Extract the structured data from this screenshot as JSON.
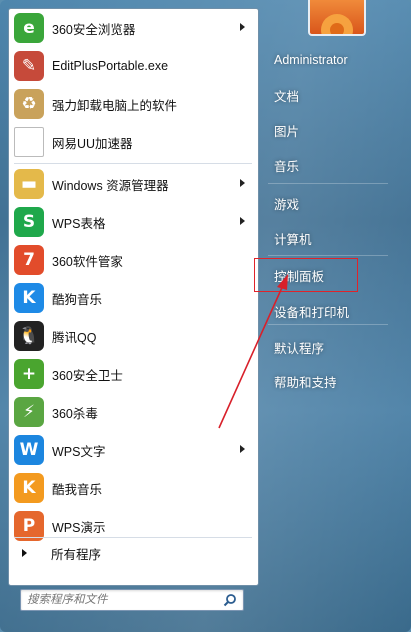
{
  "left_items": [
    {
      "label": "360安全浏览器",
      "icon": "360-browser-icon",
      "color": "#3aa63a",
      "glyph": "e",
      "submenu": true
    },
    {
      "label": "EditPlusPortable.exe",
      "icon": "editplus-icon",
      "color": "#c64a3a",
      "glyph": "✎",
      "submenu": false
    },
    {
      "label": "强力卸载电脑上的软件",
      "icon": "uninstall-box-icon",
      "color": "#c9a25b",
      "glyph": "♻",
      "submenu": false
    },
    {
      "label": "网易UU加速器",
      "icon": "document-icon",
      "color": "#ffffff",
      "glyph": "",
      "submenu": false
    },
    {
      "label": "Windows 资源管理器",
      "icon": "folder-icon",
      "color": "#e4b94a",
      "glyph": "▬",
      "submenu": true
    },
    {
      "label": "WPS表格",
      "icon": "wps-sheet-icon",
      "color": "#1fa84b",
      "glyph": "S",
      "submenu": true
    },
    {
      "label": "360软件管家",
      "icon": "software-manager-icon",
      "color": "#e24c2b",
      "glyph": "7",
      "submenu": false
    },
    {
      "label": "酷狗音乐",
      "icon": "kugou-icon",
      "color": "#1e8ae6",
      "glyph": "K",
      "submenu": false
    },
    {
      "label": "腾讯QQ",
      "icon": "qq-penguin-icon",
      "color": "#222222",
      "glyph": "🐧",
      "submenu": false
    },
    {
      "label": "360安全卫士",
      "icon": "360-guard-icon",
      "color": "#4aa52f",
      "glyph": "+",
      "submenu": false
    },
    {
      "label": "360杀毒",
      "icon": "360-antivirus-icon",
      "color": "#5aa642",
      "glyph": "⚡",
      "submenu": false
    },
    {
      "label": "WPS文字",
      "icon": "wps-writer-icon",
      "color": "#1c86df",
      "glyph": "W",
      "submenu": true
    },
    {
      "label": "酷我音乐",
      "icon": "kuwo-music-icon",
      "color": "#f39a1f",
      "glyph": "K",
      "submenu": false
    },
    {
      "label": "WPS演示",
      "icon": "wps-presentation-icon",
      "color": "#e5672d",
      "glyph": "P",
      "submenu": false
    }
  ],
  "all_programs": "所有程序",
  "search_placeholder": "搜索程序和文件",
  "right_items": [
    {
      "label": "Administrator",
      "name": "user-administrator"
    },
    {
      "label": "文档",
      "name": "documents"
    },
    {
      "label": "图片",
      "name": "pictures"
    },
    {
      "label": "音乐",
      "name": "music"
    },
    {
      "label": "游戏",
      "name": "games"
    },
    {
      "label": "计算机",
      "name": "computer"
    },
    {
      "label": "控制面板",
      "name": "control-panel"
    },
    {
      "label": "设备和打印机",
      "name": "devices-and-printers"
    },
    {
      "label": "默认程序",
      "name": "default-programs"
    },
    {
      "label": "帮助和支持",
      "name": "help-and-support"
    }
  ],
  "highlight_color": "#e0232a"
}
